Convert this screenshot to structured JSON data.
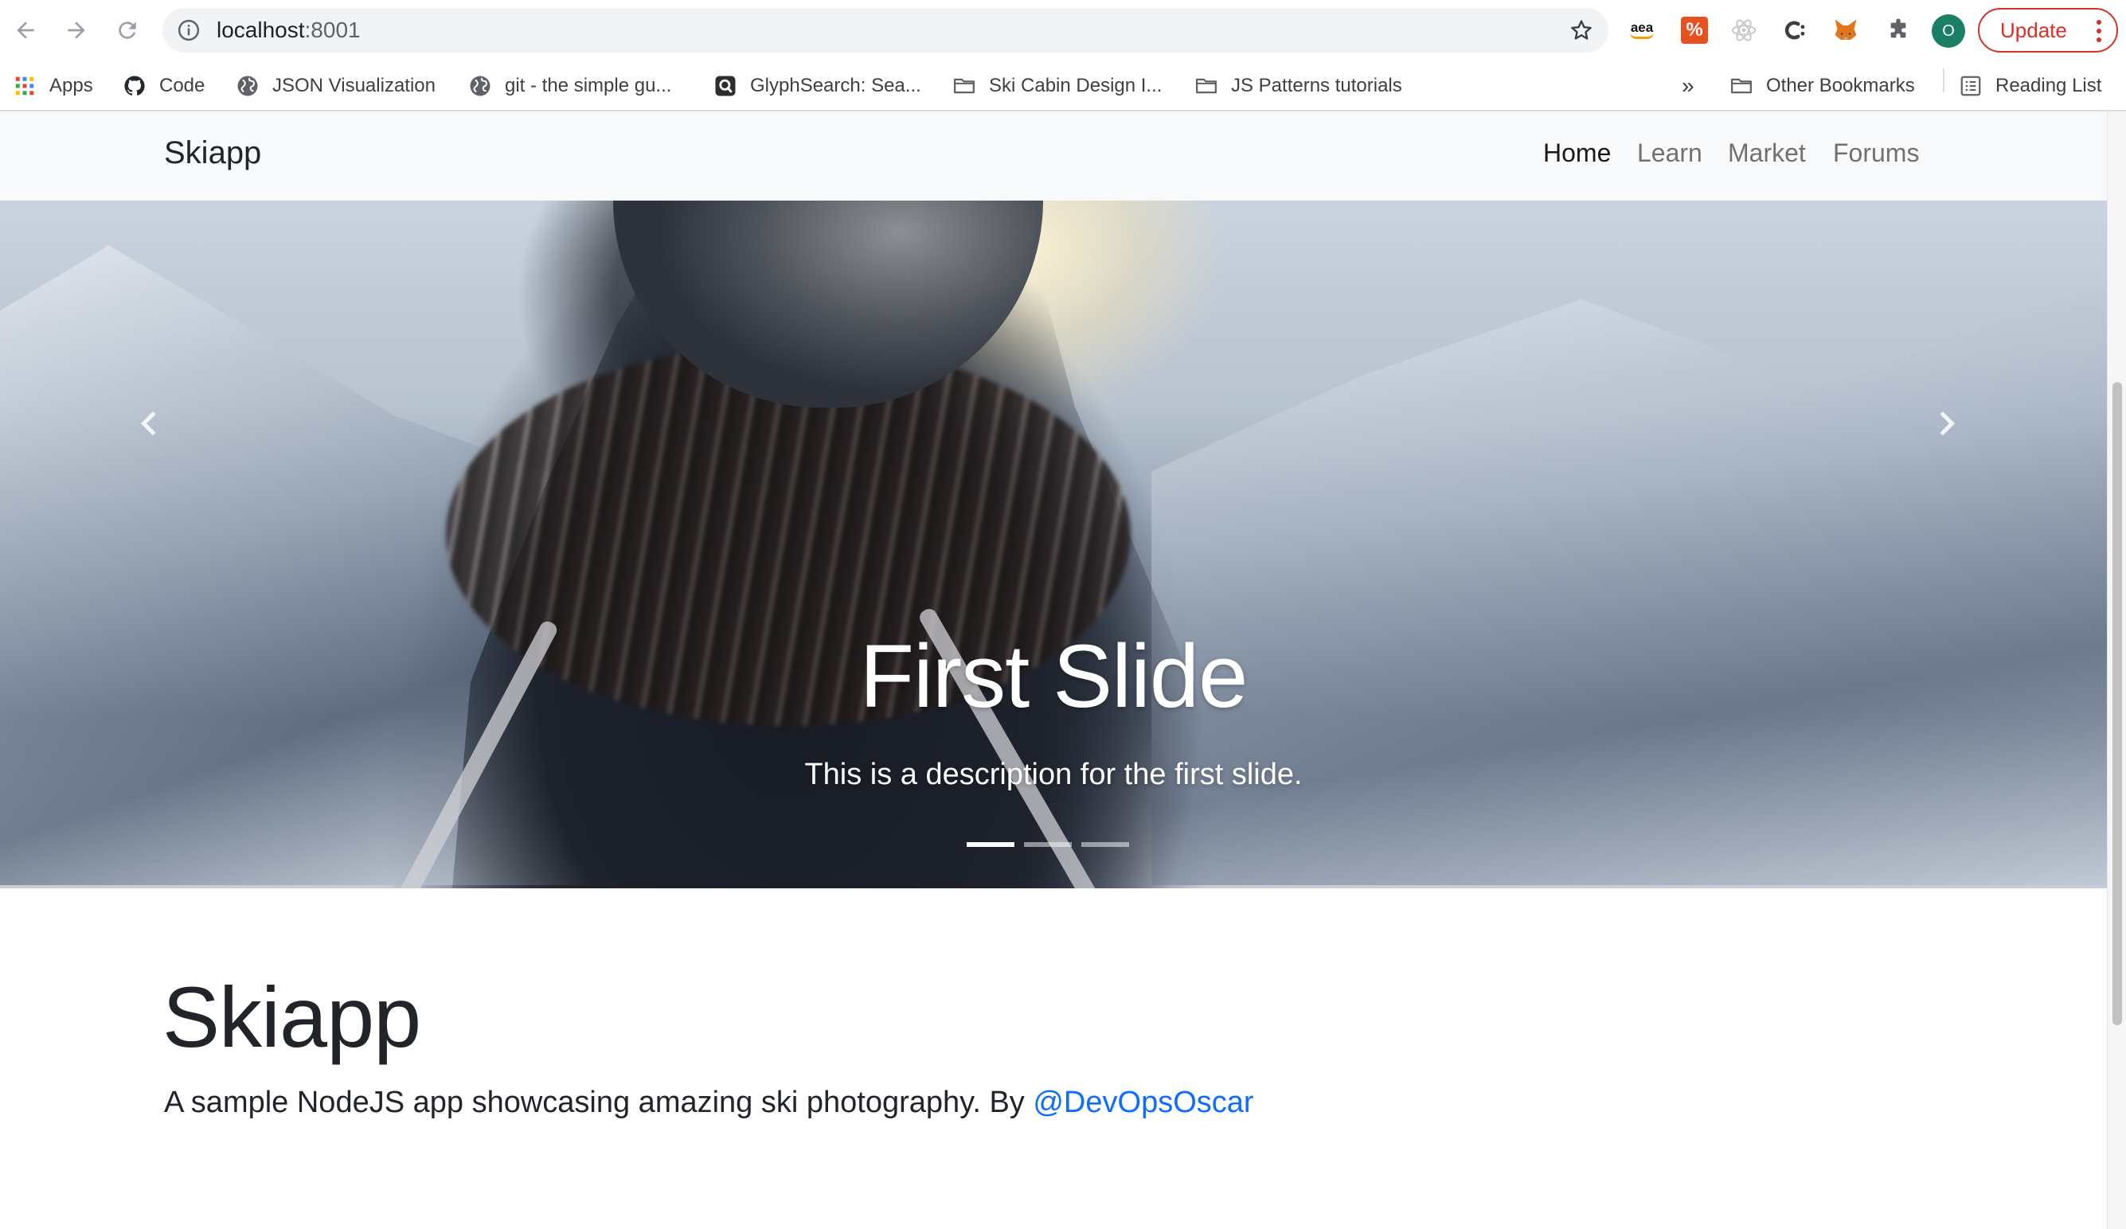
{
  "browser": {
    "url_host": "localhost",
    "url_port": ":8001",
    "update_label": "Update",
    "profile_initial": "O",
    "extensions": {
      "amazon_label": "aea",
      "percent_label": "%"
    },
    "bookmarks": [
      {
        "label": "Apps",
        "icon": "apps-grid-icon"
      },
      {
        "label": "Code",
        "icon": "github-icon"
      },
      {
        "label": "JSON Visualization",
        "icon": "globe-icon"
      },
      {
        "label": "git - the simple gu...",
        "icon": "globe-icon"
      },
      {
        "label": "GlyphSearch: Sea...",
        "icon": "glyphsearch-icon"
      },
      {
        "label": "Ski Cabin Design I...",
        "icon": "folder-icon"
      },
      {
        "label": "JS Patterns tutorials",
        "icon": "folder-icon"
      }
    ],
    "overflow_label": "»",
    "other_bookmarks": "Other Bookmarks",
    "reading_list": "Reading List"
  },
  "navbar": {
    "brand": "Skiapp",
    "links": [
      {
        "label": "Home",
        "active": true
      },
      {
        "label": "Learn",
        "active": false
      },
      {
        "label": "Market",
        "active": false
      },
      {
        "label": "Forums",
        "active": false
      }
    ]
  },
  "carousel": {
    "title": "First Slide",
    "description": "This is a description for the first slide.",
    "slide_count": 3,
    "active_slide": 1
  },
  "hero": {
    "title": "Skiapp",
    "lead": "A sample NodeJS app showcasing amazing ski photography. By ",
    "link_text": "@DevOpsOscar"
  },
  "colors": {
    "link": "#0d6efd",
    "navbar_bg": "#f8f9fa",
    "update_red": "#d93025",
    "profile_green": "#1a7f64"
  }
}
